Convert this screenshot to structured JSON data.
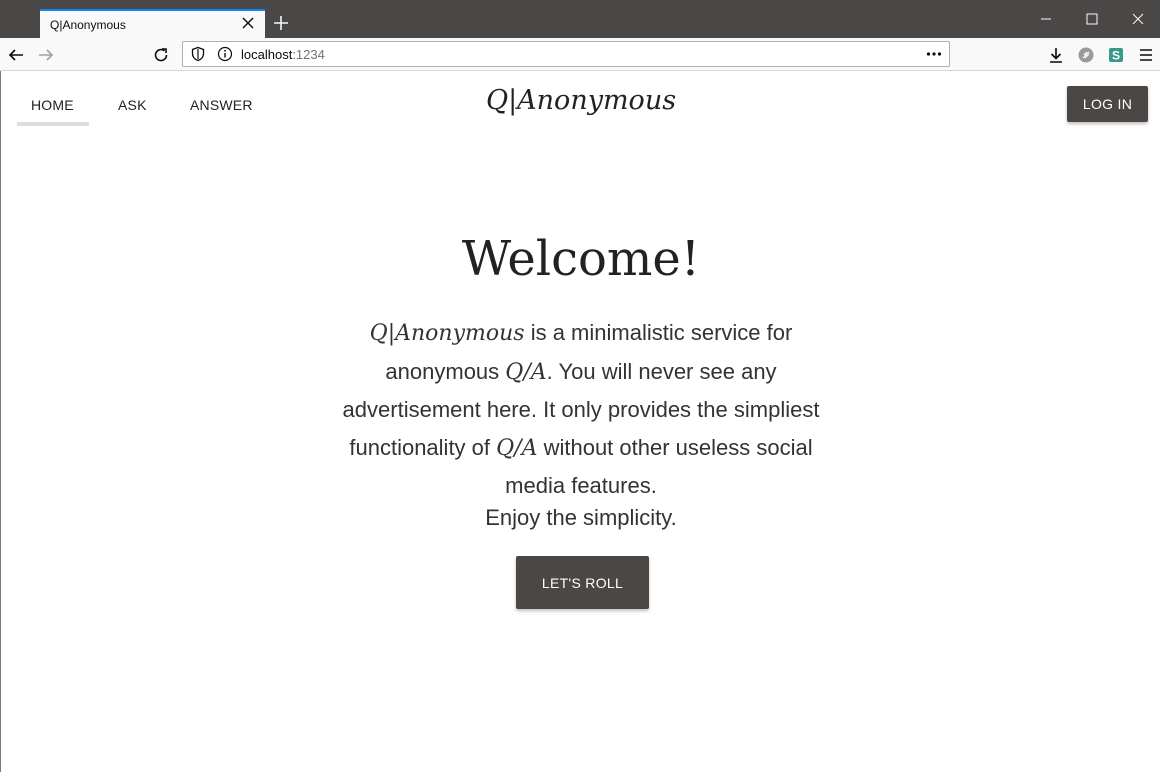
{
  "browser": {
    "tab_title": "Q|Anonymous",
    "url_host": "localhost",
    "url_port": ":1234",
    "icons": [
      "close-icon",
      "plus-icon",
      "minimize-icon",
      "maximize-icon",
      "window-close-icon",
      "back-arrow-icon",
      "forward-arrow-icon",
      "reload-icon",
      "shield-icon",
      "info-icon",
      "more-icon",
      "download-icon",
      "extension-icon",
      "s-extension-icon",
      "menu-icon"
    ]
  },
  "nav": {
    "home": "HOME",
    "ask": "ASK",
    "answer": "ANSWER",
    "brand": "Q|Anonymous",
    "login": "LOG IN"
  },
  "hero": {
    "title": "Welcome!",
    "intro": {
      "p1_em": "Q|Anonymous",
      "p1": " is a minimalistic service for anonymous ",
      "p2_em": "Q/A",
      "p2": ". You will never see any advertisement here. It only provides the simpliest functionality of ",
      "p3_em": "Q/A",
      "p3": " without other useless social media features."
    },
    "enjoy": "Enjoy the simplicity.",
    "cta": "LET'S ROLL"
  }
}
